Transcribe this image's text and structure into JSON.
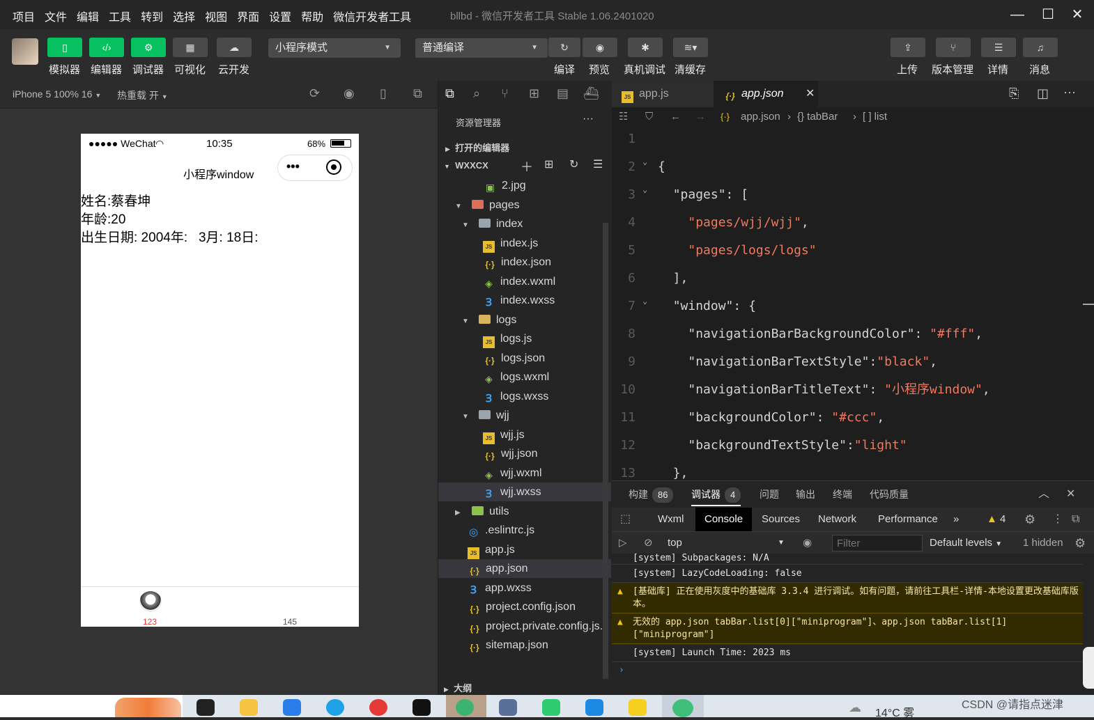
{
  "menu": [
    "项目",
    "文件",
    "编辑",
    "工具",
    "转到",
    "选择",
    "视图",
    "界面",
    "设置",
    "帮助",
    "微信开发者工具"
  ],
  "window_title": "bllbd - 微信开发者工具 Stable 1.06.2401020",
  "window_controls": {
    "minimize": "—",
    "maximize": "☐",
    "close": "✕"
  },
  "toolbar": {
    "buttons": {
      "simulator": "模拟器",
      "editor": "编辑器",
      "debugger": "调试器",
      "visual": "可视化",
      "cloud": "云开发"
    },
    "mode_select": "小程序模式",
    "compile_select": "普通编译",
    "actions": {
      "compile": "编译",
      "preview": "预览",
      "remote_debug": "真机调试",
      "clear_cache": "清缓存"
    },
    "right": {
      "upload": "上传",
      "version": "版本管理",
      "details": "详情",
      "messages": "消息"
    }
  },
  "simulator": {
    "device": "iPhone 5 100% 16",
    "hotreload": "热重载 开",
    "status": {
      "carrier": "●●●●● WeChat",
      "time": "10:35",
      "battery": "68%"
    },
    "nav_title": "小程序window",
    "content": [
      "姓名:蔡春坤",
      "年龄:20",
      "出生日期: 2004年:   3月: 18日:"
    ],
    "tabbar": [
      {
        "label": "123",
        "color": "#e53935"
      },
      {
        "label": "145",
        "color": "#555555"
      }
    ]
  },
  "explorer": {
    "title": "资源管理器",
    "open_editors": "打开的编辑器",
    "project": "WXXCX",
    "outline": "大纲",
    "files": [
      {
        "name": "2.jpg",
        "type": "img",
        "depth": 2
      },
      {
        "name": "pages",
        "type": "folderr",
        "depth": 1,
        "open": true
      },
      {
        "name": "index",
        "type": "folder",
        "depth": 2,
        "open": true
      },
      {
        "name": "index.js",
        "type": "js",
        "depth": 3
      },
      {
        "name": "index.json",
        "type": "json",
        "depth": 3
      },
      {
        "name": "index.wxml",
        "type": "wxml",
        "depth": 3
      },
      {
        "name": "index.wxss",
        "type": "wxss",
        "depth": 3
      },
      {
        "name": "logs",
        "type": "foldery",
        "depth": 2,
        "open": true
      },
      {
        "name": "logs.js",
        "type": "js",
        "depth": 3
      },
      {
        "name": "logs.json",
        "type": "json",
        "depth": 3
      },
      {
        "name": "logs.wxml",
        "type": "wxml",
        "depth": 3
      },
      {
        "name": "logs.wxss",
        "type": "wxss",
        "depth": 3
      },
      {
        "name": "wjj",
        "type": "folder",
        "depth": 2,
        "open": true
      },
      {
        "name": "wjj.js",
        "type": "js",
        "depth": 3
      },
      {
        "name": "wjj.json",
        "type": "json",
        "depth": 3
      },
      {
        "name": "wjj.wxml",
        "type": "wxml",
        "depth": 3
      },
      {
        "name": "wjj.wxss",
        "type": "wxss",
        "depth": 3,
        "selected": true
      },
      {
        "name": "utils",
        "type": "folderg",
        "depth": 1,
        "open": false
      },
      {
        "name": ".eslintrc.js",
        "type": "eslint",
        "depth": 1
      },
      {
        "name": "app.js",
        "type": "js",
        "depth": 1
      },
      {
        "name": "app.json",
        "type": "json",
        "depth": 1,
        "selected": true
      },
      {
        "name": "app.wxss",
        "type": "wxss",
        "depth": 1
      },
      {
        "name": "project.config.json",
        "type": "json",
        "depth": 1
      },
      {
        "name": "project.private.config.js...",
        "type": "json",
        "depth": 1
      },
      {
        "name": "sitemap.json",
        "type": "json",
        "depth": 1
      }
    ]
  },
  "editor": {
    "tabs": [
      {
        "label": "app.js",
        "icon": "js"
      },
      {
        "label": "app.json",
        "icon": "json",
        "active": true
      }
    ],
    "breadcrumb": [
      "app.json",
      "{} tabBar",
      "[ ] list"
    ],
    "lines": [
      {
        "n": "1",
        "t": ""
      },
      {
        "n": "2",
        "t": "{",
        "fold": true
      },
      {
        "n": "3",
        "t": "  \"pages\": [",
        "fold": true
      },
      {
        "n": "4",
        "t": "    \"pages/wjj/wjj\","
      },
      {
        "n": "5",
        "t": "    \"pages/logs/logs\""
      },
      {
        "n": "6",
        "t": "  ],"
      },
      {
        "n": "7",
        "t": "  \"window\": {",
        "fold": true
      },
      {
        "n": "8",
        "t": "    \"navigationBarBackgroundColor\": \"#fff\","
      },
      {
        "n": "9",
        "t": "    \"navigationBarTextStyle\":\"black\","
      },
      {
        "n": "10",
        "t": "    \"navigationBarTitleText\": \"小程序window\","
      },
      {
        "n": "11",
        "t": "    \"backgroundColor\": \"#ccc\","
      },
      {
        "n": "12",
        "t": "    \"backgroundTextStyle\":\"light\""
      },
      {
        "n": "13",
        "t": "  },"
      }
    ]
  },
  "debug": {
    "tabs": [
      {
        "label": "构建",
        "badge": "86"
      },
      {
        "label": "调试器",
        "badge": "4",
        "active": true
      },
      {
        "label": "问题"
      },
      {
        "label": "输出"
      },
      {
        "label": "终端"
      },
      {
        "label": "代码质量"
      }
    ],
    "devtools_tabs": [
      "Wxml",
      "Console",
      "Sources",
      "Network",
      "Performance"
    ],
    "warn_count": "4",
    "context": "top",
    "filter_placeholder": "Filter",
    "levels": "Default levels",
    "hidden": "1 hidden",
    "logs": [
      {
        "text": "[system] Subpackages: N/A",
        "level": "info"
      },
      {
        "text": "[system] LazyCodeLoading: false",
        "level": "info"
      },
      {
        "text": "[基础库] 正在使用灰度中的基础库 3.3.4 进行调试。如有问题，请前往工具栏-详情-本地设置更改基础库版本。",
        "level": "warn"
      },
      {
        "text": "无效的 app.json tabBar.list[0][\"miniprogram\"]、app.json tabBar.list[1][\"miniprogram\"]",
        "level": "warn"
      },
      {
        "text": "[system] Launch Time: 2023 ms",
        "level": "info"
      }
    ],
    "prompt": "›"
  },
  "taskbar": {
    "weather": "14°C 雾",
    "watermark": "CSDN @请指点迷津"
  }
}
